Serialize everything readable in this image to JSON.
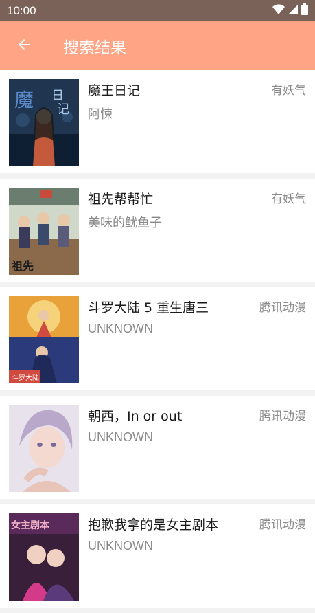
{
  "status_bar": {
    "time": "10:00"
  },
  "app_bar": {
    "title": "搜索结果",
    "back_icon": "arrow-left-icon"
  },
  "results": [
    {
      "title": "魔王日记",
      "author": "阿悚",
      "source": "有妖气",
      "cover_colors": [
        "#1f3550",
        "#c45a3c",
        "#e6c1a0"
      ]
    },
    {
      "title": "祖先帮帮忙",
      "author": "美味的鱿鱼子",
      "source": "有妖气",
      "cover_colors": [
        "#cfd8c9",
        "#3a3a5a",
        "#c84a3a"
      ]
    },
    {
      "title": "斗罗大陆 5 重生唐三",
      "author": "UNKNOWN",
      "source": "腾讯动漫",
      "cover_colors": [
        "#e9a23a",
        "#2a3a7a",
        "#d04a40"
      ]
    },
    {
      "title": "朝西，In or out",
      "author": "UNKNOWN",
      "source": "腾讯动漫",
      "cover_colors": [
        "#e8e2ec",
        "#b9a8c9",
        "#e7c3b8"
      ]
    },
    {
      "title": "抱歉我拿的是女主剧本",
      "author": "UNKNOWN",
      "source": "腾讯动漫",
      "cover_colors": [
        "#3a1f3a",
        "#d43a8a",
        "#f0b0c8"
      ]
    }
  ]
}
